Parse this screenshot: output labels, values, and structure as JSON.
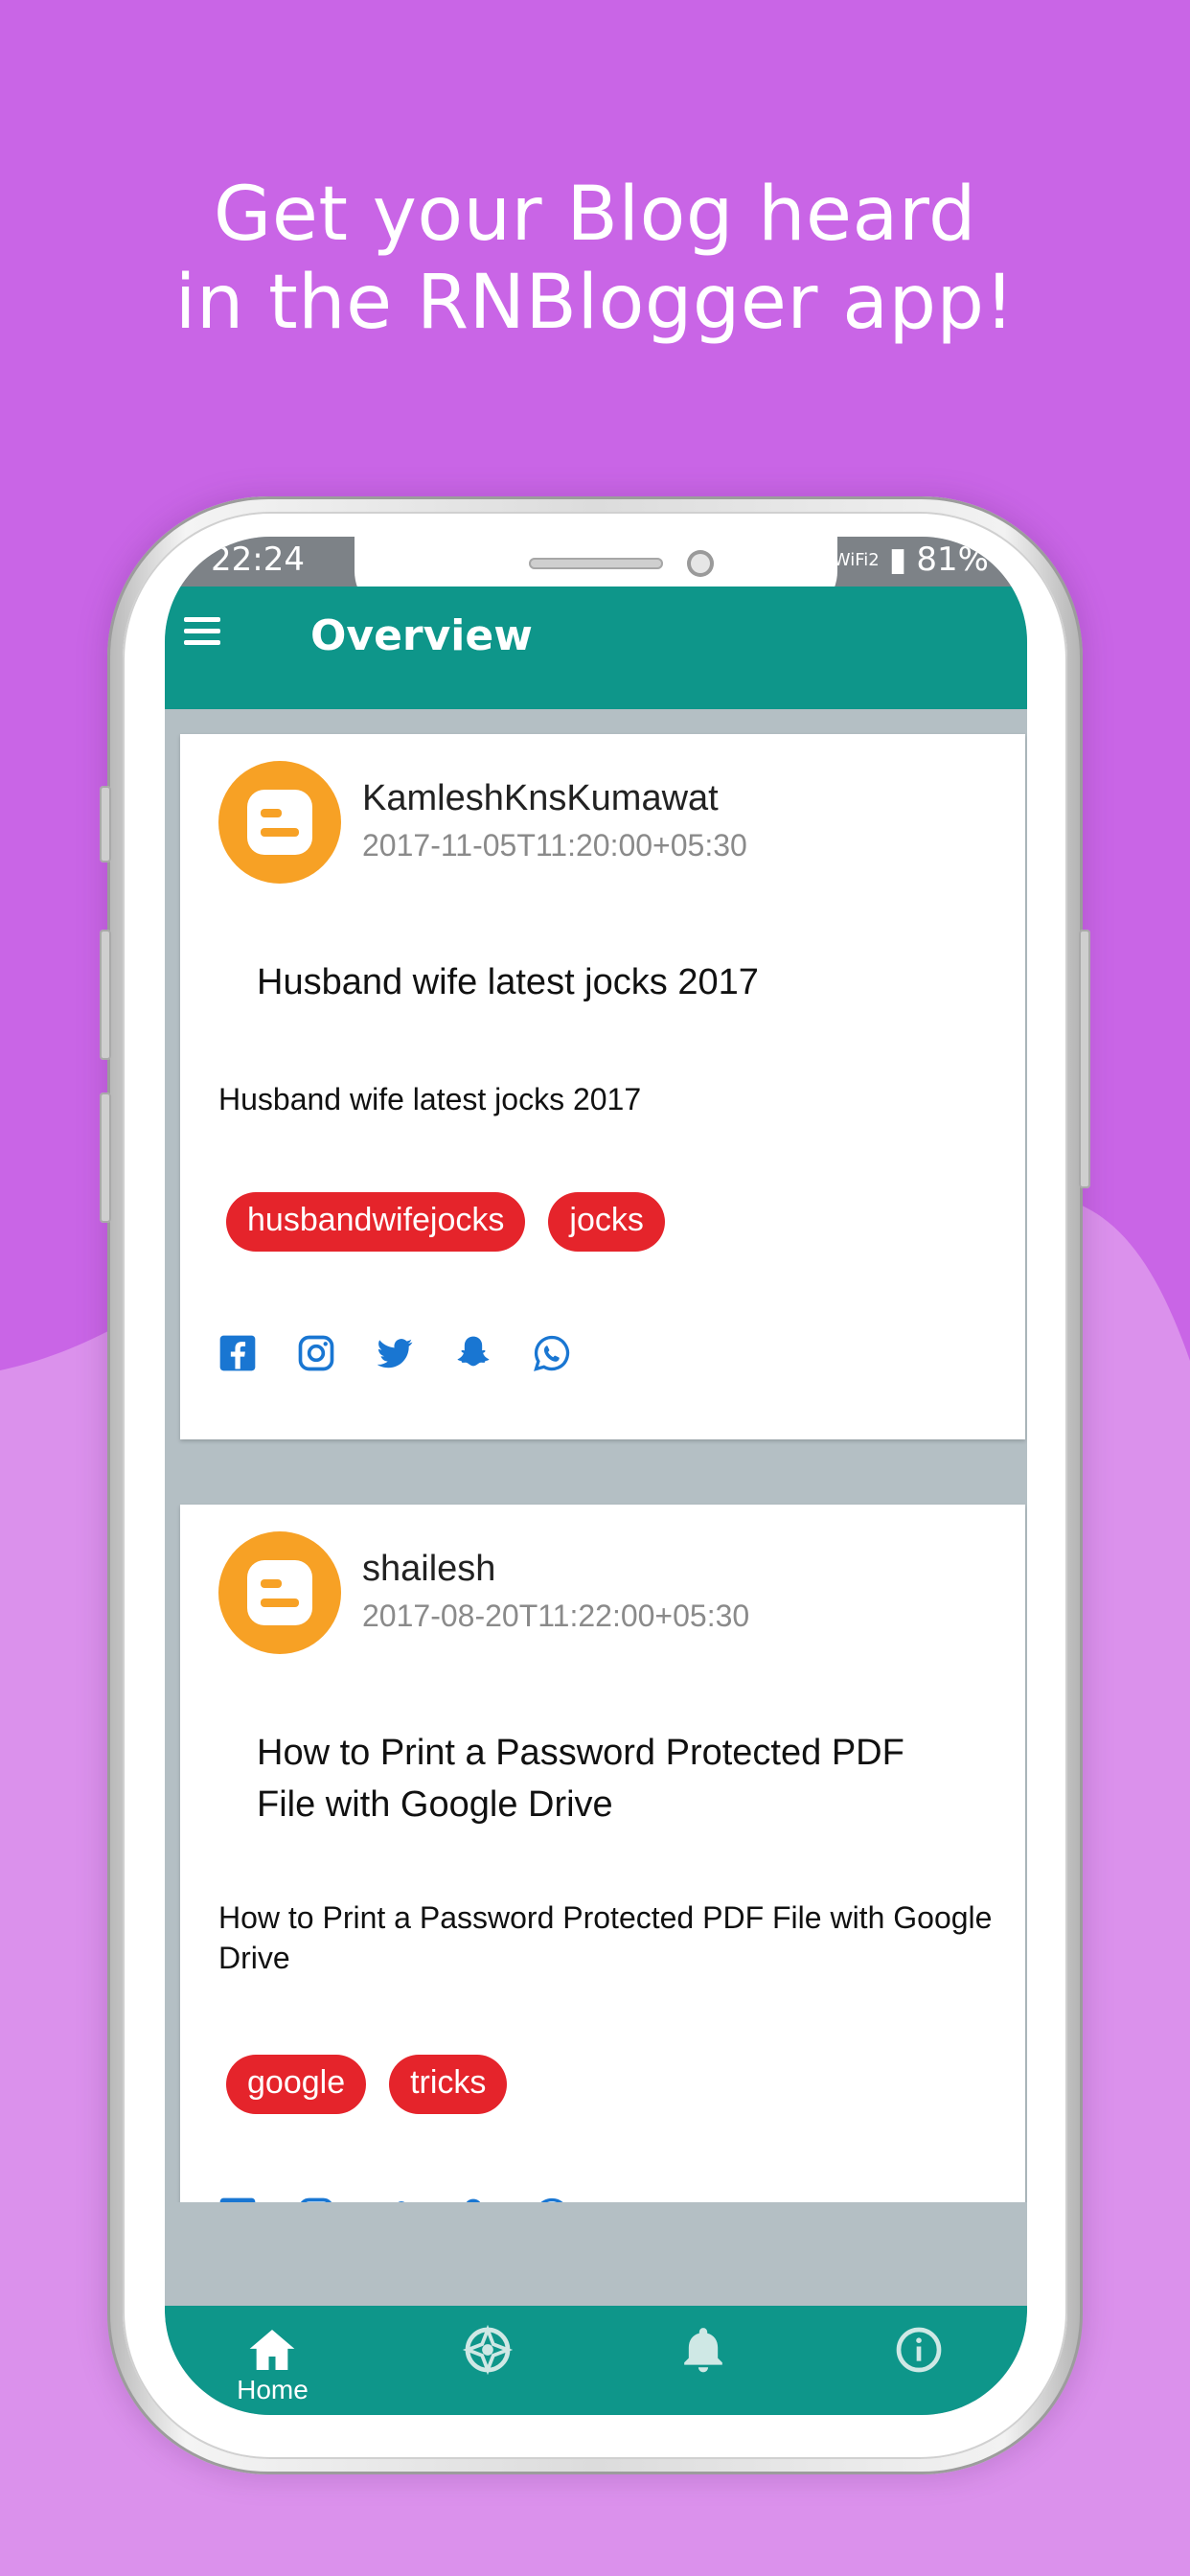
{
  "promo": {
    "line1": "Get your Blog heard",
    "line2": "in the RNBlogger app!"
  },
  "colors": {
    "background": "#c965e6",
    "background_lower": "#db91ec",
    "primary": "#0e968a",
    "tag": "#e5242b",
    "share_icons": "#1976d2"
  },
  "status": {
    "time": "22:24",
    "network": "WiFi2",
    "battery": "81%"
  },
  "appbar": {
    "title": "Overview",
    "menu_icon": "hamburger-menu-icon"
  },
  "posts": [
    {
      "author": "KamleshKnsKumawat",
      "date": "2017-11-05T11:20:00+05:30",
      "title": "Husband wife latest jocks 2017",
      "description": "Husband wife latest jocks 2017",
      "tags": [
        "husbandwifejocks",
        "jocks"
      ],
      "avatar_icon": "blogger-icon"
    },
    {
      "author": "shailesh",
      "date": "2017-08-20T11:22:00+05:30",
      "title": "How to Print a Password Protected PDF File with Google Drive",
      "description": "How to Print a Password Protected PDF File with Google Drive",
      "tags": [
        "google",
        "tricks"
      ],
      "avatar_icon": "blogger-icon"
    }
  ],
  "share_icons": [
    "facebook-icon",
    "instagram-icon",
    "twitter-icon",
    "snapchat-icon",
    "whatsapp-icon"
  ],
  "bottom_nav": [
    {
      "label": "Home",
      "icon": "home-icon",
      "active": true
    },
    {
      "label": "",
      "icon": "aperture-icon",
      "active": false
    },
    {
      "label": "",
      "icon": "bell-icon",
      "active": false
    },
    {
      "label": "",
      "icon": "info-icon",
      "active": false
    }
  ]
}
